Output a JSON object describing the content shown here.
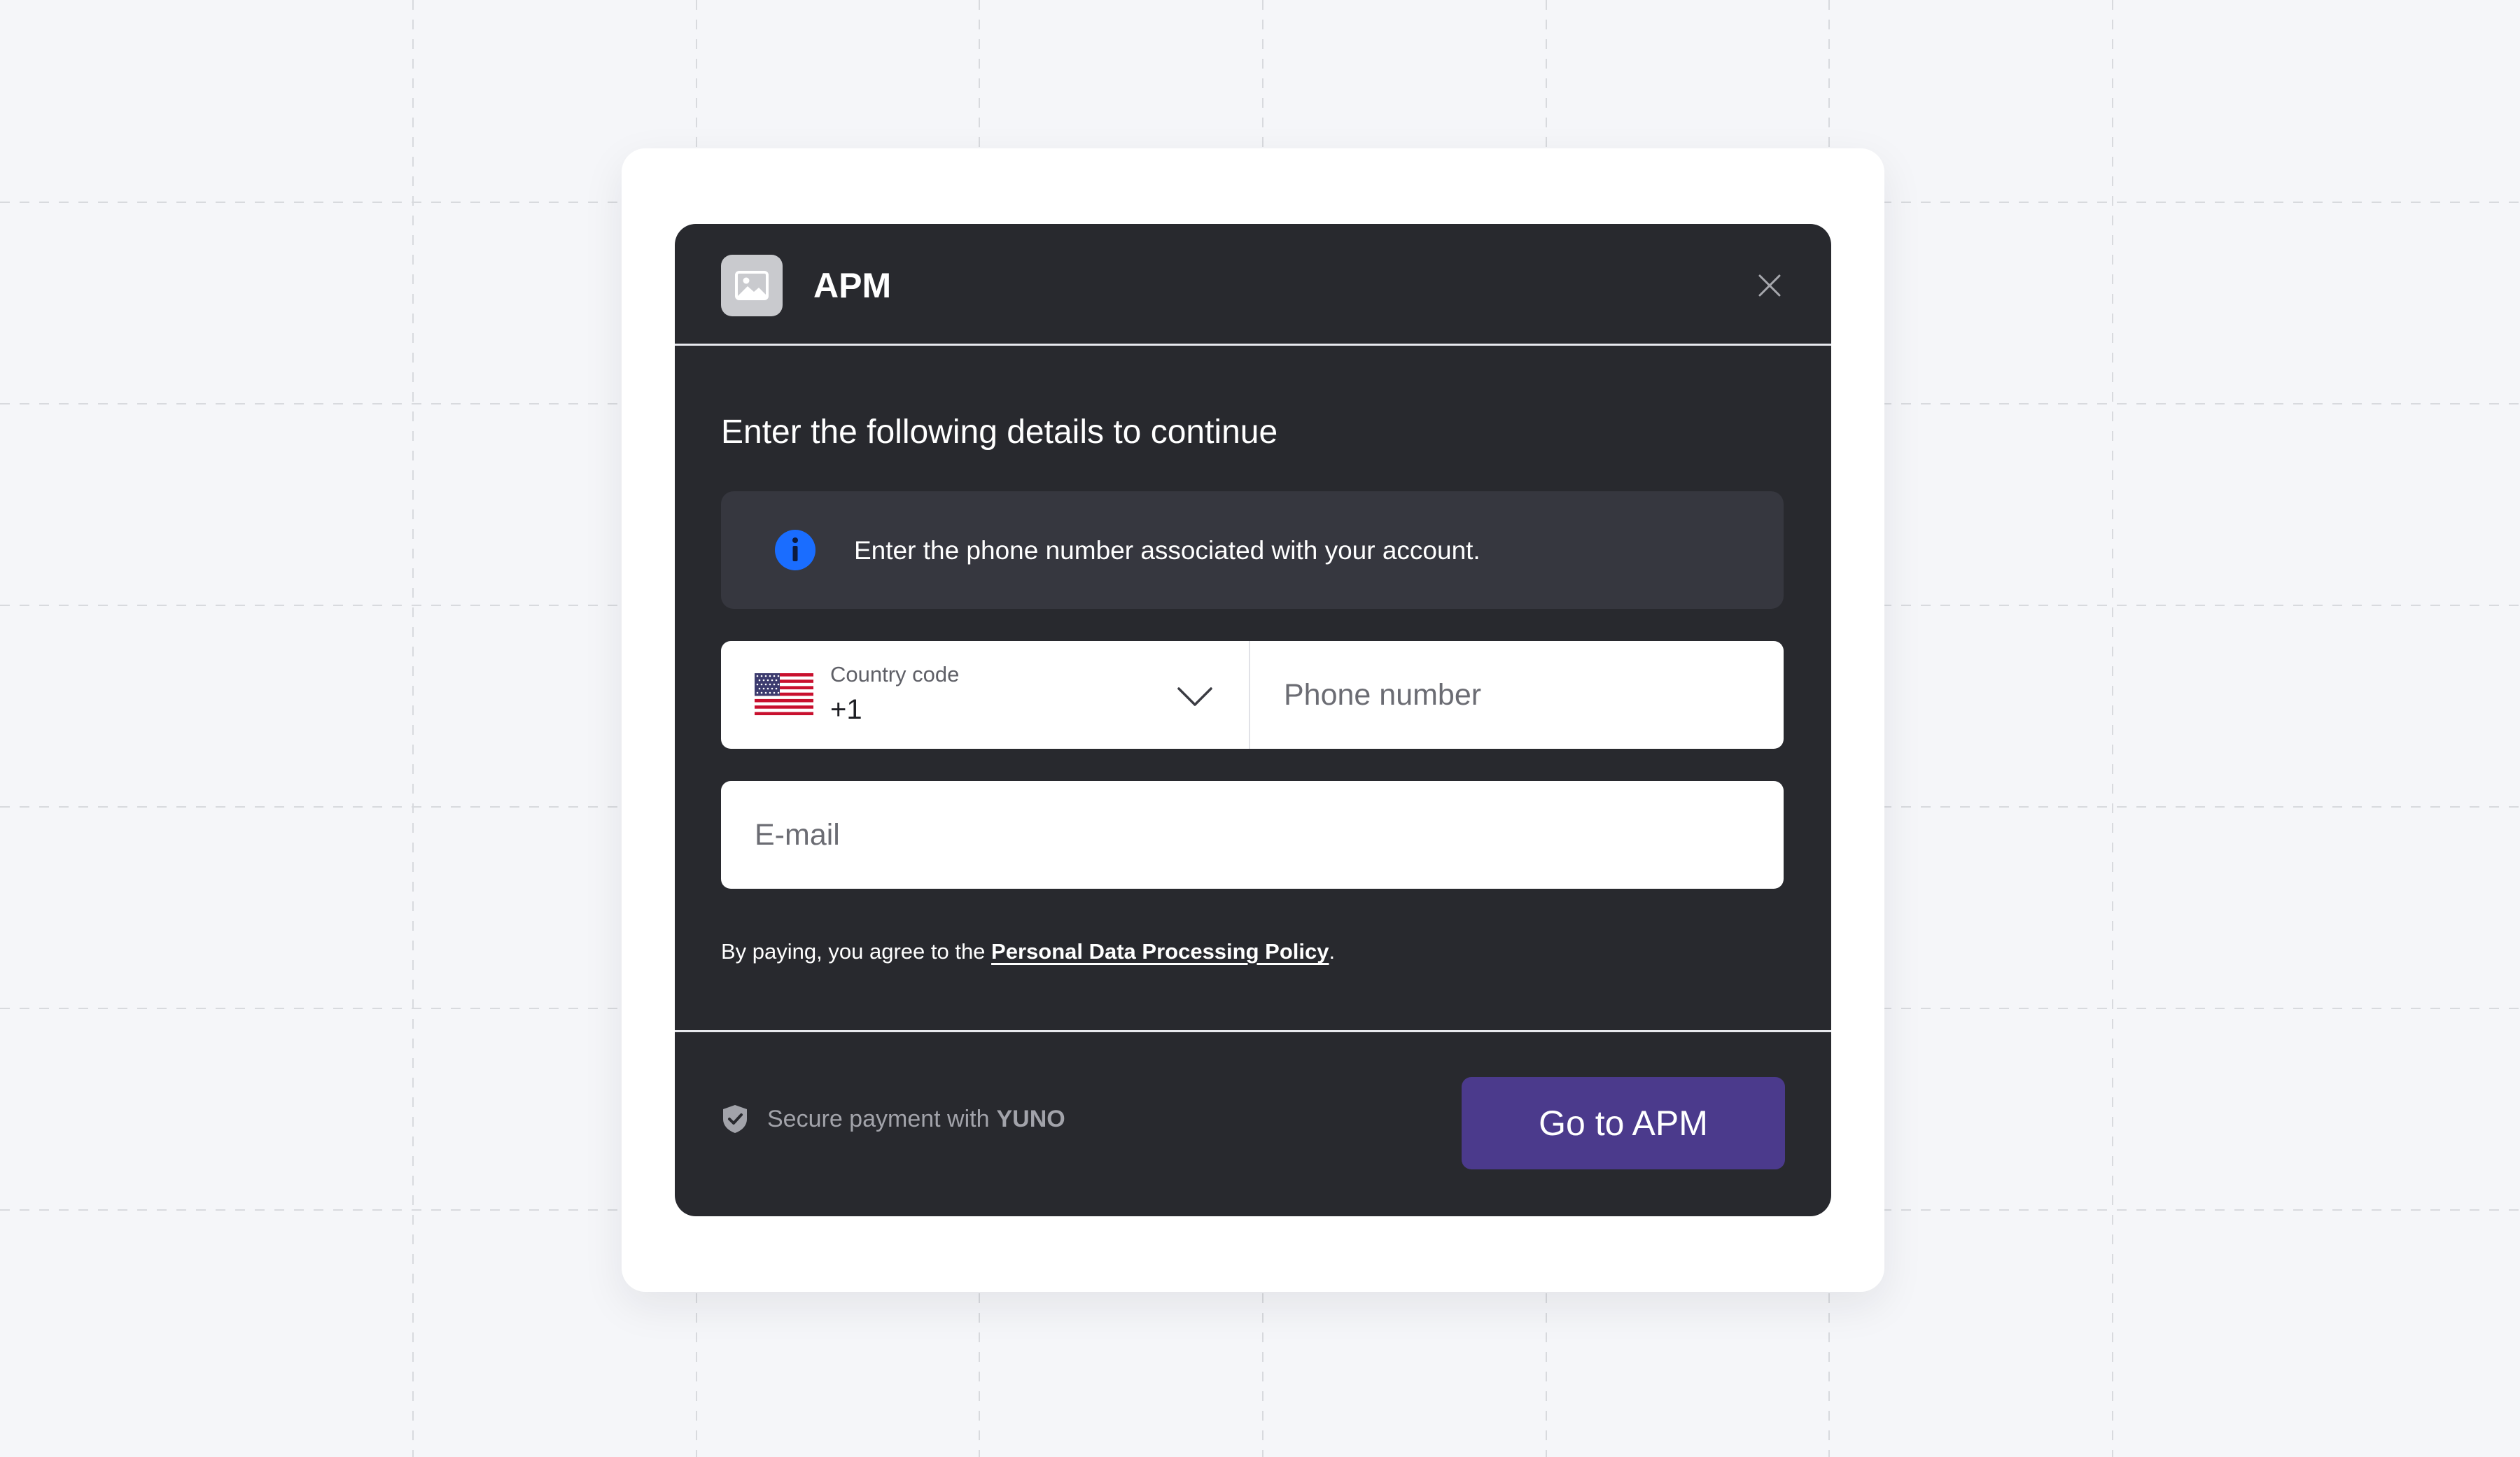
{
  "app": {
    "title": "APM",
    "logo_icon": "image-placeholder-icon"
  },
  "form": {
    "heading": "Enter the following details to continue",
    "info_message": "Enter the phone number associated with your account.",
    "country_code_label": "Country code",
    "country_code_value": "+1",
    "country_flag": "us-flag-icon",
    "phone_placeholder": "Phone number",
    "email_placeholder": "E-mail",
    "policy_prefix": "By paying, you agree to the ",
    "policy_link": "Personal Data Processing Policy",
    "policy_suffix": "."
  },
  "footer": {
    "secure_text": "Secure payment with",
    "brand": "YUNO",
    "cta_label": "Go to APM"
  },
  "colors": {
    "modal_bg": "#28292e",
    "info_bg": "#36373f",
    "info_icon": "#1a6dff",
    "cta_bg": "#4b3a8c",
    "page_bg": "#f5f6f9"
  }
}
